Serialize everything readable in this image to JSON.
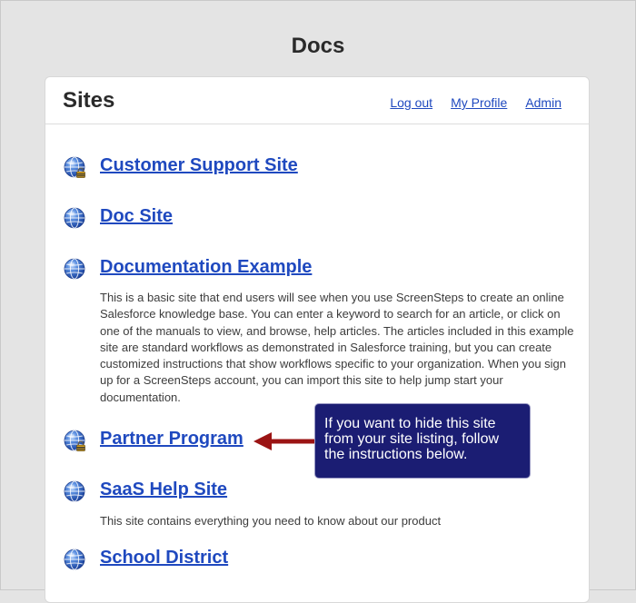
{
  "app": {
    "title": "Docs"
  },
  "panel": {
    "title": "Sites",
    "nav": [
      {
        "label": "Log out"
      },
      {
        "label": "My Profile"
      },
      {
        "label": "Admin"
      }
    ]
  },
  "sites": [
    {
      "name": "Customer Support Site",
      "icon": "globe-lock-icon",
      "description": ""
    },
    {
      "name": "Doc Site",
      "icon": "globe-icon",
      "description": ""
    },
    {
      "name": "Documentation Example",
      "icon": "globe-icon",
      "description": "This is a basic site that end users will see when you use ScreenSteps to create an online Salesforce knowledge base. You can enter a keyword to search for an article, or click on one of the manuals to view, and browse, help articles. The articles included in this example site are standard workflows as demonstrated in Salesforce training, but you can create customized instructions that show workflows specific to your organization. When you sign up for a ScreenSteps account, you can import this site to help jump start your documentation."
    },
    {
      "name": "Partner Program",
      "icon": "globe-lock-icon",
      "description": ""
    },
    {
      "name": "SaaS Help Site",
      "icon": "globe-icon",
      "description": "This site contains everything you need to know about our product"
    },
    {
      "name": "School District",
      "icon": "globe-icon",
      "description": ""
    }
  ],
  "callout": {
    "text": "If you want to hide this site from your site listing, follow the instructions below.",
    "color": "#1b1d73",
    "arrow_color": "#9b1414"
  },
  "colors": {
    "link": "#1f49bf",
    "background": "#e4e4e4"
  }
}
